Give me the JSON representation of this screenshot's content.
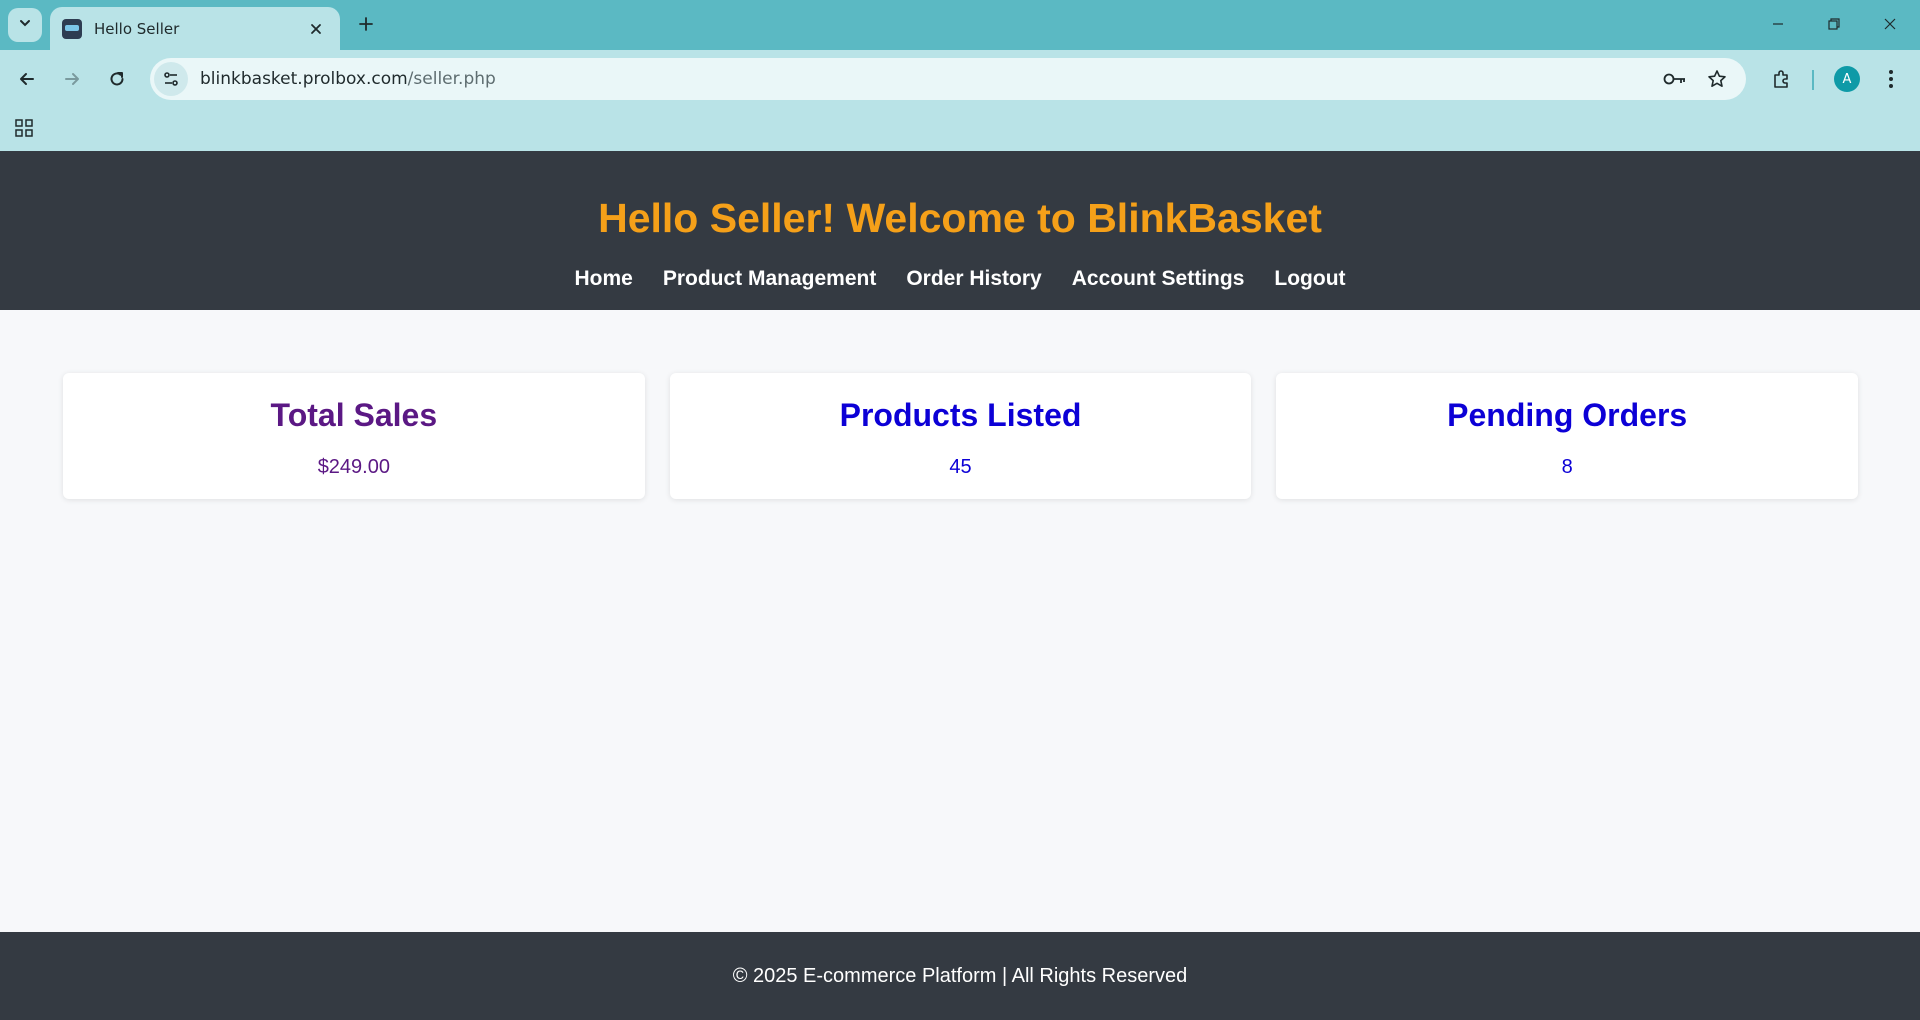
{
  "browser": {
    "tab_title": "Hello Seller",
    "url_host": "blinkbasket.prolbox.com",
    "url_path": "/seller.php",
    "profile_initial": "A",
    "accent": "#5bb9c3",
    "profile_color": "#0e9aa7"
  },
  "header": {
    "title": "Hello Seller! Welcome to BlinkBasket",
    "title_color": "#f5a019",
    "nav": [
      "Home",
      "Product Management",
      "Order History",
      "Account Settings",
      "Logout"
    ]
  },
  "cards": [
    {
      "title": "Total Sales",
      "value": "$249.00",
      "color": "#5b1884"
    },
    {
      "title": "Products Listed",
      "value": "45",
      "color": "#0c00d6"
    },
    {
      "title": "Pending Orders",
      "value": "8",
      "color": "#0c00d6"
    }
  ],
  "footer": {
    "text": "© 2025 E-commerce Platform | All Rights Reserved"
  }
}
